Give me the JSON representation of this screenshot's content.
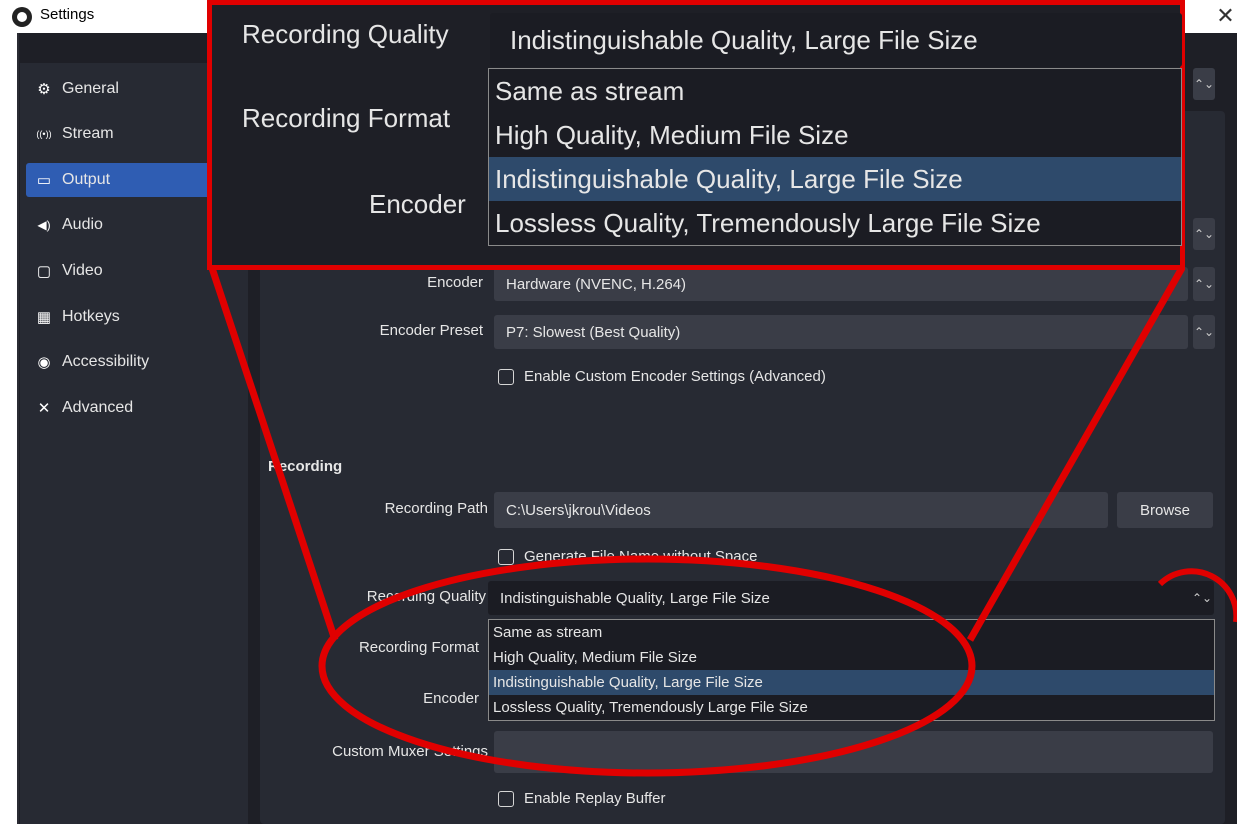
{
  "window": {
    "title": "Settings",
    "close_glyph": "✕"
  },
  "sidebar": {
    "items": [
      {
        "label": "General",
        "icon": "gear-icon",
        "glyph": "⚙"
      },
      {
        "label": "Stream",
        "icon": "antenna-icon",
        "glyph": "((•))"
      },
      {
        "label": "Output",
        "icon": "output-icon",
        "glyph": "▭"
      },
      {
        "label": "Audio",
        "icon": "speaker-icon",
        "glyph": "◀)"
      },
      {
        "label": "Video",
        "icon": "monitor-icon",
        "glyph": "▢"
      },
      {
        "label": "Hotkeys",
        "icon": "keyboard-icon",
        "glyph": "▦"
      },
      {
        "label": "Accessibility",
        "icon": "accessibility-icon",
        "glyph": "◉"
      },
      {
        "label": "Advanced",
        "icon": "tools-icon",
        "glyph": "✕"
      }
    ],
    "active_index": 2
  },
  "streaming": {
    "encoder_label": "Encoder",
    "encoder_value": "Hardware (NVENC, H.264)",
    "preset_label": "Encoder Preset",
    "preset_value": "P7: Slowest (Best Quality)",
    "custom_encoder_label": "Enable Custom Encoder Settings (Advanced)"
  },
  "recording": {
    "section_title": "Recording",
    "path_label": "Recording Path",
    "path_value": "C:\\Users\\jkrou\\Videos",
    "browse_label": "Browse",
    "no_space_label": "Generate File Name without Space",
    "quality_label": "Recording Quality",
    "quality_value": "Indistinguishable Quality, Large File Size",
    "format_label": "Recording Format",
    "encoder_label": "Encoder",
    "muxer_label": "Custom Muxer Settings",
    "replay_label": "Enable Replay Buffer"
  },
  "quality_options": [
    "Same as stream",
    "High Quality, Medium File Size",
    "Indistinguishable Quality, Large File Size",
    "Lossless Quality, Tremendously Large File Size"
  ],
  "quality_selected_index": 2,
  "colors": {
    "annotation_red": "#e00000",
    "active_nav": "#2f5db3",
    "selected_option": "#2e4a6b"
  }
}
